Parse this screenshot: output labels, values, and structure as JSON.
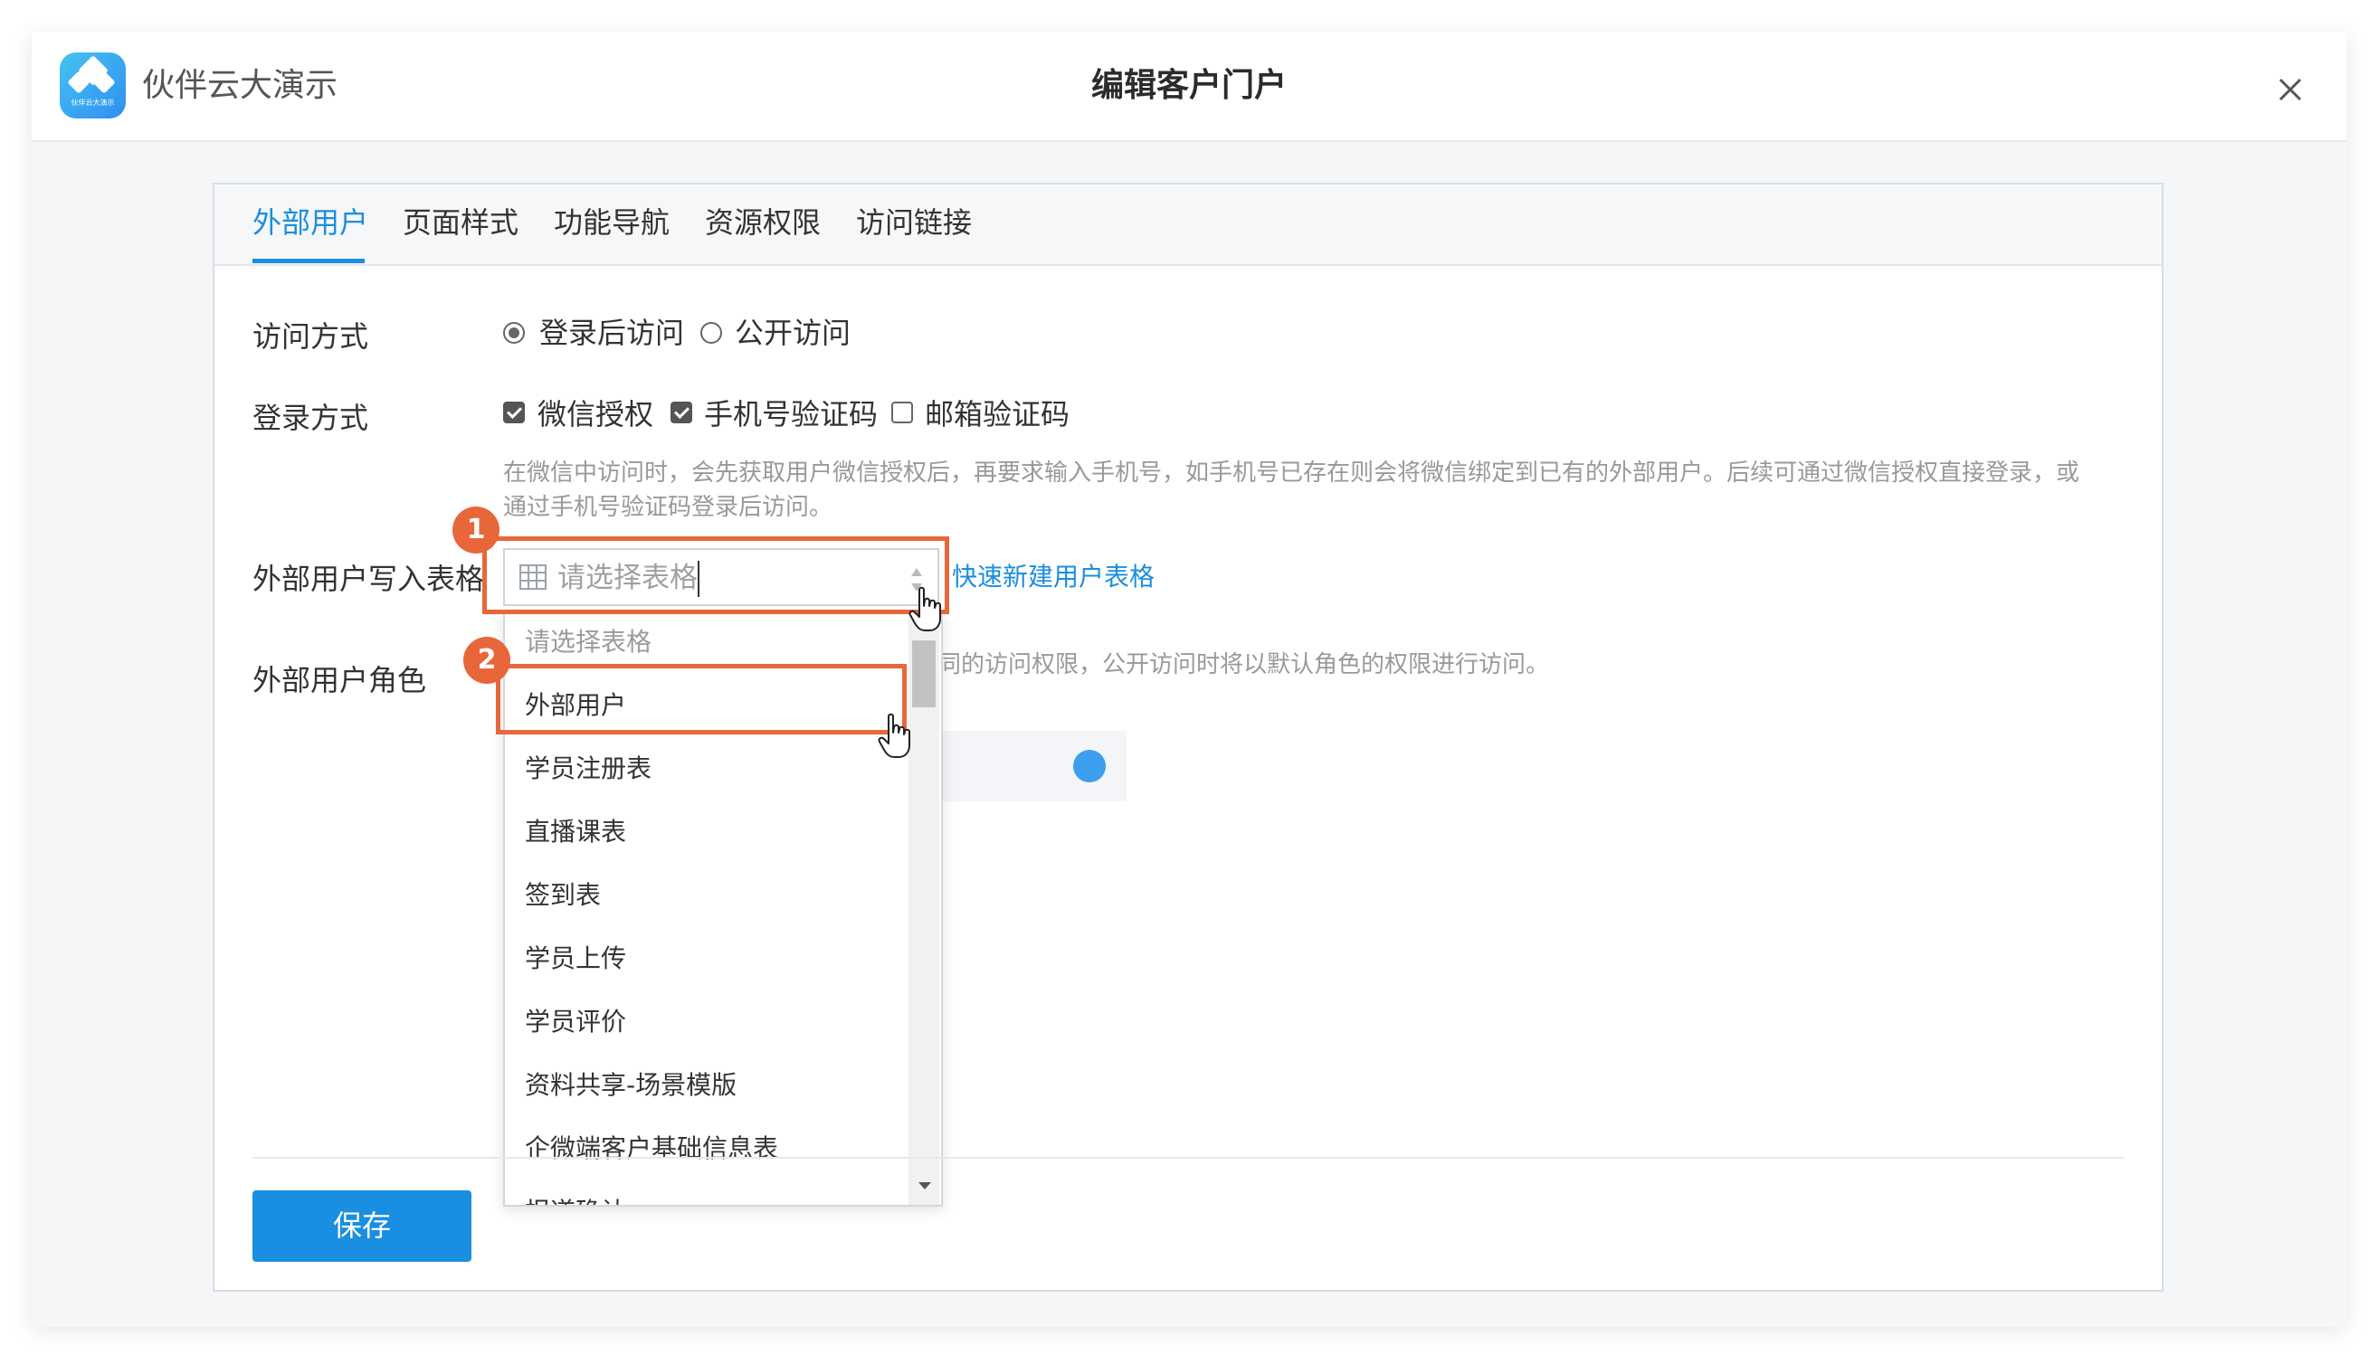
{
  "app": {
    "name": "伙伴云大演示",
    "logo_small_text": "伙伴云大演示"
  },
  "modal": {
    "title": "编辑客户门户"
  },
  "tabs": [
    {
      "label": "外部用户",
      "active": true
    },
    {
      "label": "页面样式",
      "active": false
    },
    {
      "label": "功能导航",
      "active": false
    },
    {
      "label": "资源权限",
      "active": false
    },
    {
      "label": "访问链接",
      "active": false
    }
  ],
  "form": {
    "access": {
      "label": "访问方式",
      "options": [
        {
          "label": "登录后访问",
          "checked": true
        },
        {
          "label": "公开访问",
          "checked": false
        }
      ]
    },
    "login": {
      "label": "登录方式",
      "options": [
        {
          "label": "微信授权",
          "checked": true
        },
        {
          "label": "手机号验证码",
          "checked": true
        },
        {
          "label": "邮箱验证码",
          "checked": false
        }
      ],
      "hint_line1": "在微信中访问时，会先获取用户微信授权后，再要求输入手机号，如手机号已存在则会将微信绑定到已有的外部用户。后续可通过微信授权直接登录，或",
      "hint_line2": "通过手机号验证码登录后访问。"
    },
    "write_table": {
      "label": "外部用户写入表格",
      "placeholder": "请选择表格",
      "quick_create": "快速新建用户表格"
    },
    "role": {
      "label": "外部用户角色",
      "hint_partial": "同的访问权限，公开访问时将以默认角色的权限进行访问。"
    }
  },
  "dropdown": {
    "items": [
      {
        "label": "请选择表格",
        "muted": true
      },
      {
        "label": "外部用户",
        "muted": false
      },
      {
        "label": "学员注册表",
        "muted": false
      },
      {
        "label": "直播课表",
        "muted": false
      },
      {
        "label": "签到表",
        "muted": false
      },
      {
        "label": "学员上传",
        "muted": false
      },
      {
        "label": "学员评价",
        "muted": false
      },
      {
        "label": "资料共享-场景模版",
        "muted": false
      },
      {
        "label": "企微端客户基础信息表",
        "muted": false
      },
      {
        "label": "报道确认",
        "muted": false
      }
    ]
  },
  "annotations": {
    "step1": "1",
    "step2": "2",
    "color": "#e8673a"
  },
  "buttons": {
    "save": "保存"
  },
  "colors": {
    "accent": "#1a8ee0",
    "highlight": "#e8673a",
    "toggle": "#3d9ef0"
  }
}
